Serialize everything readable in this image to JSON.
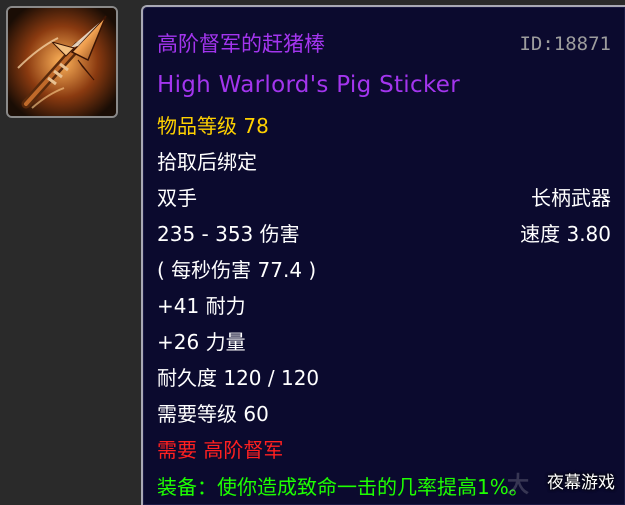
{
  "item": {
    "icon": "spear-icon",
    "name_cn": "高阶督军的赶猪棒",
    "id_label": "ID:18871",
    "name_en": "High Warlord's Pig Sticker",
    "item_level_label": "物品等级",
    "item_level_value": "78",
    "bind": "拾取后绑定",
    "slot": "双手",
    "type": "长柄武器",
    "damage": "235 - 353 伤害",
    "speed": "速度 3.80",
    "dps": "( 每秒伤害 77.4 )",
    "stamina": "+41 耐力",
    "strength": "+26 力量",
    "durability": "耐久度 120 / 120",
    "required_level": "需要等级 60",
    "required_rank": "需要 高阶督军",
    "equip_effect": "装备：使你造成致命一击的几率提高1%。"
  },
  "watermark": {
    "faint_text": "大",
    "site_name": "夜幕游戏"
  },
  "colors": {
    "epic": "#a335ee",
    "item_level": "#ffd100",
    "requirement_unmet": "#ff2020",
    "equip_effect": "#1eff00",
    "id_label": "#9d9d9d",
    "tooltip_background": "#0b0a2e"
  }
}
